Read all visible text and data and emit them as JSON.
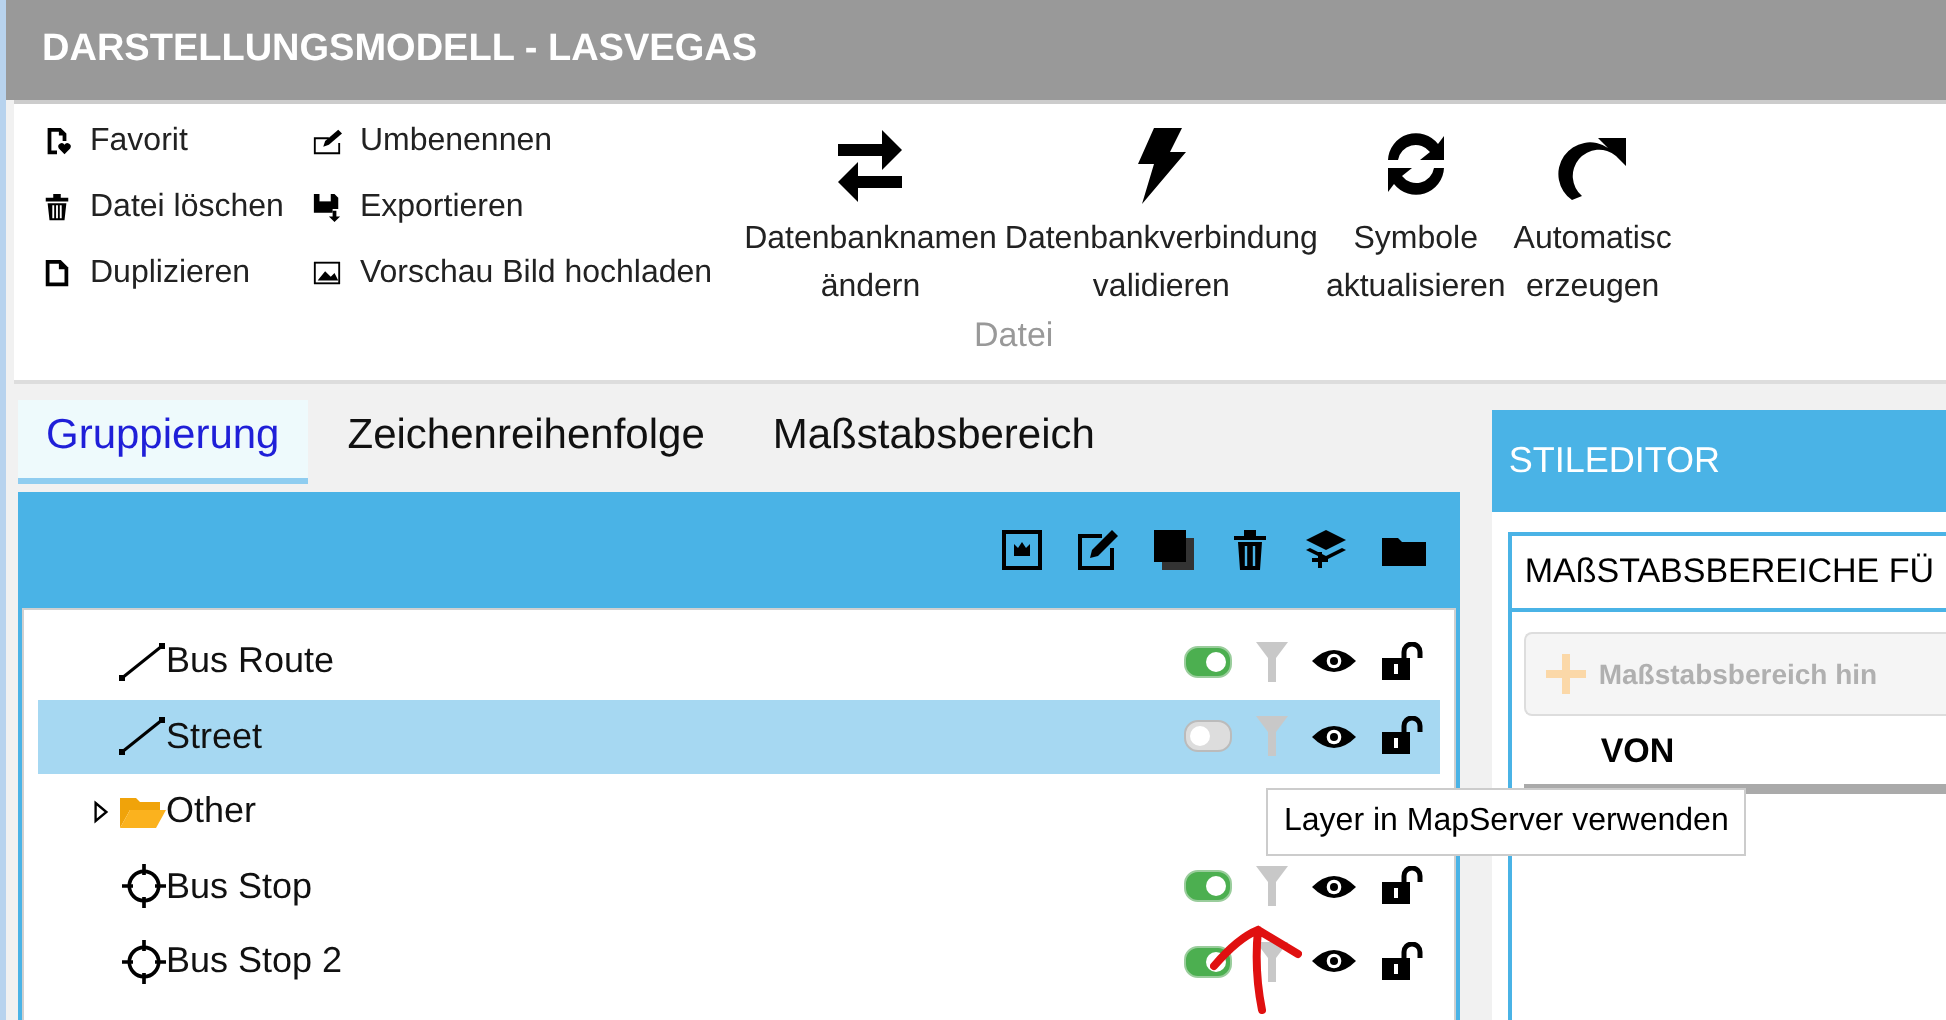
{
  "window": {
    "title": "DARSTELLUNGSMODELL - LASVEGAS"
  },
  "ribbon": {
    "small_columns": [
      [
        {
          "label": "Favorit"
        },
        {
          "label": "Datei löschen"
        },
        {
          "label": "Duplizieren"
        }
      ],
      [
        {
          "label": "Umbenennen"
        },
        {
          "label": "Exportieren"
        },
        {
          "label": "Vorschau Bild hochladen"
        }
      ]
    ],
    "large_buttons": [
      {
        "lines": [
          "Datenbanknamen",
          "ändern"
        ]
      },
      {
        "lines": [
          "Datenbankverbindung",
          "validieren"
        ]
      },
      {
        "lines": [
          "Symbole",
          "aktualisieren"
        ]
      },
      {
        "lines": [
          "Automatisc",
          "erzeugen"
        ]
      }
    ],
    "group_label": "Datei"
  },
  "tabs": [
    {
      "label": "Gruppierung",
      "selected": true
    },
    {
      "label": "Zeichenreihenfolge",
      "selected": false
    },
    {
      "label": "Maßstabsbereich",
      "selected": false
    }
  ],
  "tree": [
    {
      "kind": "line",
      "label": "Bus Route",
      "selected": false,
      "on": true
    },
    {
      "kind": "line",
      "label": "Street",
      "selected": true,
      "on": false
    },
    {
      "kind": "folder",
      "label": "Other",
      "selected": false,
      "expanded": false
    },
    {
      "kind": "point",
      "label": "Bus Stop",
      "selected": false,
      "on": true
    },
    {
      "kind": "point",
      "label": "Bus Stop 2",
      "selected": false,
      "on": true
    }
  ],
  "tooltip": "Layer in MapServer verwenden",
  "style_editor": {
    "title": "STILEDITOR",
    "section": "MAßSTABSBEREICHE FÜ",
    "add_button": {
      "label": "Maßstabsbereich hin",
      "disabled": true
    },
    "column": "VON"
  }
}
